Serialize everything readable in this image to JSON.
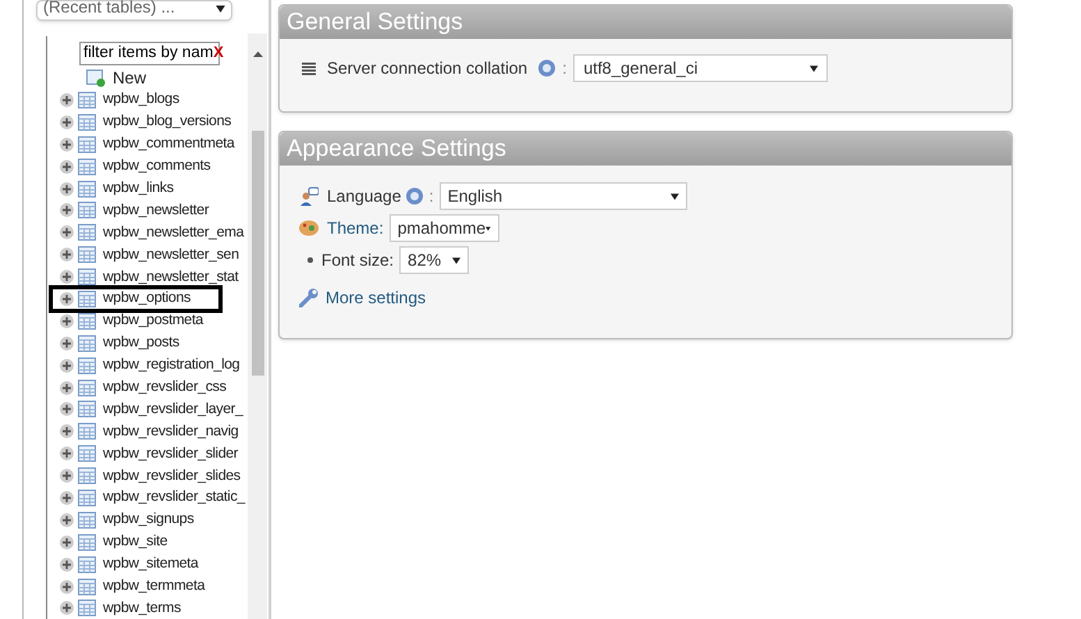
{
  "sidebar": {
    "recent_tables": {
      "value": "(Recent tables) ..."
    },
    "filter": {
      "value": "filter items by nam",
      "clear": "X"
    },
    "new_item": {
      "label": "New"
    },
    "tables": [
      {
        "name": "wpbw_blogs",
        "highlighted": false
      },
      {
        "name": "wpbw_blog_versions",
        "highlighted": false
      },
      {
        "name": "wpbw_commentmeta",
        "highlighted": false
      },
      {
        "name": "wpbw_comments",
        "highlighted": false
      },
      {
        "name": "wpbw_links",
        "highlighted": false
      },
      {
        "name": "wpbw_newsletter",
        "highlighted": false
      },
      {
        "name": "wpbw_newsletter_ema",
        "highlighted": false
      },
      {
        "name": "wpbw_newsletter_sen",
        "highlighted": false
      },
      {
        "name": "wpbw_newsletter_stat",
        "highlighted": false
      },
      {
        "name": "wpbw_options",
        "highlighted": true
      },
      {
        "name": "wpbw_postmeta",
        "highlighted": false
      },
      {
        "name": "wpbw_posts",
        "highlighted": false
      },
      {
        "name": "wpbw_registration_log",
        "highlighted": false
      },
      {
        "name": "wpbw_revslider_css",
        "highlighted": false
      },
      {
        "name": "wpbw_revslider_layer_",
        "highlighted": false
      },
      {
        "name": "wpbw_revslider_navig",
        "highlighted": false
      },
      {
        "name": "wpbw_revslider_slider",
        "highlighted": false
      },
      {
        "name": "wpbw_revslider_slides",
        "highlighted": false
      },
      {
        "name": "wpbw_revslider_static_",
        "highlighted": false
      },
      {
        "name": "wpbw_signups",
        "highlighted": false
      },
      {
        "name": "wpbw_site",
        "highlighted": false
      },
      {
        "name": "wpbw_sitemeta",
        "highlighted": false
      },
      {
        "name": "wpbw_termmeta",
        "highlighted": false
      },
      {
        "name": "wpbw_terms",
        "highlighted": false
      }
    ]
  },
  "general_settings": {
    "title": "General Settings",
    "collation_label": "Server connection collation",
    "separator": ":",
    "collation_value": "utf8_general_ci"
  },
  "appearance_settings": {
    "title": "Appearance Settings",
    "language_label": "Language",
    "language_separator": ":",
    "language_value": "English",
    "theme_label": "Theme:",
    "theme_value": "pmahomme",
    "font_size_label": "Font size:",
    "font_size_value": "82%",
    "more_settings": "More settings"
  }
}
